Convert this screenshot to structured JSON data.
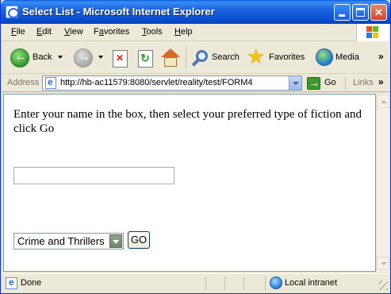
{
  "window": {
    "title": "Select List - Microsoft Internet Explorer"
  },
  "menubar": {
    "items": [
      {
        "key": "F",
        "rest": "ile"
      },
      {
        "key": "E",
        "rest": "dit"
      },
      {
        "key": "V",
        "rest": "iew"
      },
      {
        "pre": "F",
        "key": "a",
        "rest": "vorites"
      },
      {
        "key": "T",
        "rest": "ools"
      },
      {
        "key": "H",
        "rest": "elp"
      }
    ]
  },
  "toolbar": {
    "back_label": "Back",
    "search_label": "Search",
    "favorites_label": "Favorites",
    "media_label": "Media",
    "icons": [
      "back-icon",
      "forward-icon",
      "stop-icon",
      "refresh-icon",
      "home-icon",
      "search-icon",
      "favorites-icon",
      "media-icon"
    ]
  },
  "addressbar": {
    "label": "Address",
    "url": "http://hb-ac11579:8080/servlet/reality/test/FORM4",
    "go_label": "Go",
    "links_label": "Links"
  },
  "page": {
    "instructions": "Enter your name in the box, then select your preferred type of fiction and click Go",
    "name_value": "",
    "fiction_selected": "Crime and Thrillers",
    "submit_label": "GO"
  },
  "statusbar": {
    "text": "Done",
    "zone": "Local intranet"
  },
  "colors": {
    "titlebar": "#0a4fd0",
    "chrome": "#ece9d8",
    "content_bg": "#ffffff"
  }
}
